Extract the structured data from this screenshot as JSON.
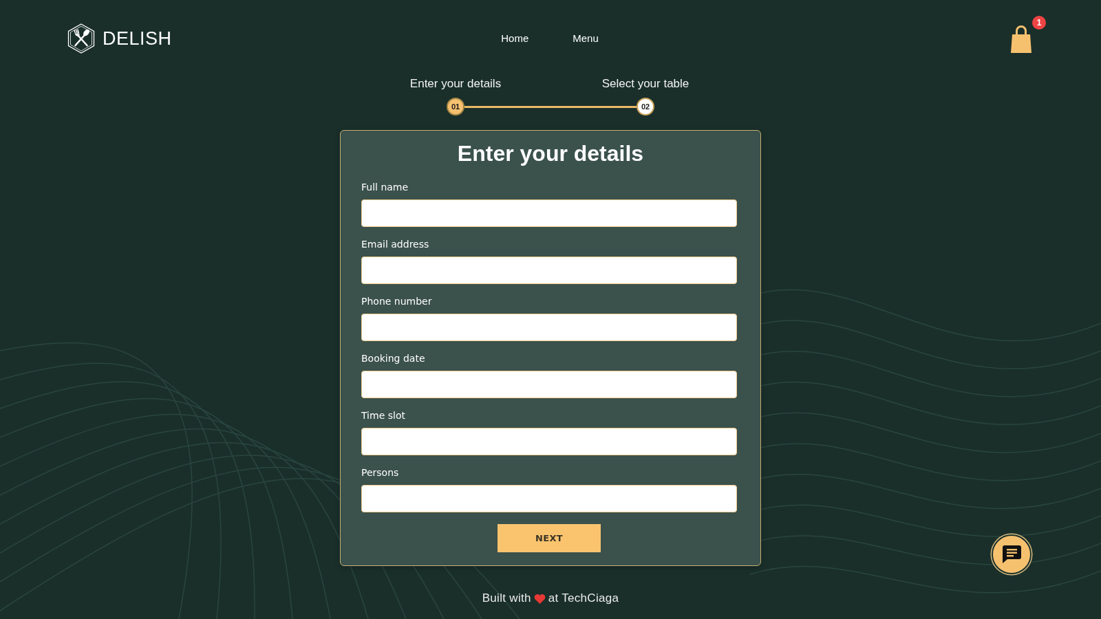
{
  "header": {
    "logo_text": "DELISH",
    "nav": [
      {
        "label": "Home"
      },
      {
        "label": "Menu"
      }
    ],
    "cart_badge": "1"
  },
  "stepper": [
    {
      "label": "Enter your details",
      "number": "01",
      "selected": true
    },
    {
      "label": "Select your table",
      "number": "02",
      "selected": false
    }
  ],
  "form": {
    "title": "Enter your details",
    "fields": [
      {
        "label": "Full name"
      },
      {
        "label": "Email address"
      },
      {
        "label": "Phone number"
      },
      {
        "label": "Booking date"
      },
      {
        "label": "Time slot"
      },
      {
        "label": "Persons"
      }
    ],
    "submit": "NEXT"
  },
  "footer": {
    "before": "Built with",
    "after": "at TechCiaga"
  }
}
